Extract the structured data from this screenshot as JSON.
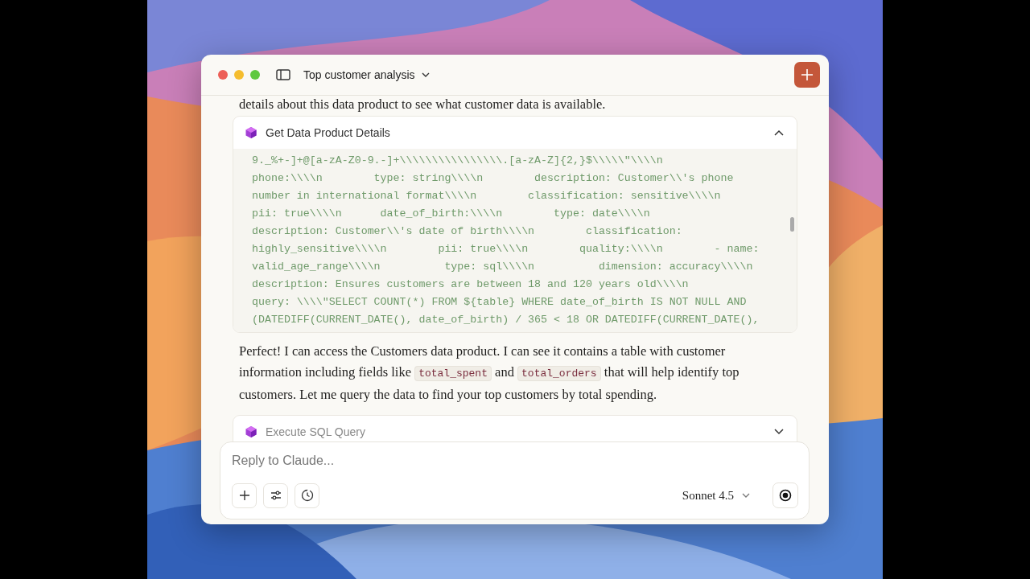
{
  "window": {
    "title": "Top customer analysis"
  },
  "messages": [
    {
      "kind": "text",
      "parts": [
        {
          "kind": "text",
          "text": "details about this data product to see what customer data is available."
        }
      ]
    },
    {
      "kind": "tool",
      "title": "Get Data Product Details",
      "expanded": true,
      "code": [
        "9._%+-]+@[a-zA-Z0-9.-]+\\\\\\\\\\\\\\\\\\\\\\\\\\\\\\\\.[a-zA-Z]{2,}$\\\\\\\\\\\"\\\\\\\\n",
        "phone:\\\\\\\\n        type: string\\\\\\\\n        description: Customer\\\\'s phone",
        "number in international format\\\\\\\\n        classification: sensitive\\\\\\\\n",
        "pii: true\\\\\\\\n      date_of_birth:\\\\\\\\n        type: date\\\\\\\\n",
        "description: Customer\\\\'s date of birth\\\\\\\\n        classification:",
        "highly_sensitive\\\\\\\\n        pii: true\\\\\\\\n        quality:\\\\\\\\n        - name:",
        "valid_age_range\\\\\\\\n          type: sql\\\\\\\\n          dimension: accuracy\\\\\\\\n",
        "description: Ensures customers are between 18 and 120 years old\\\\\\\\n",
        "query: \\\\\\\\\"SELECT COUNT(*) FROM ${table} WHERE date_of_birth IS NOT NULL AND",
        "(DATEDIFF(CURRENT_DATE(), date_of_birth) / 365 < 18 OR DATEDIFF(CURRENT_DATE(),"
      ]
    },
    {
      "kind": "text",
      "parts": [
        {
          "kind": "text",
          "text": "Perfect! I can access the Customers data product. I can see it contains a table with customer information including fields like "
        },
        {
          "kind": "code",
          "text": "total_spent"
        },
        {
          "kind": "text",
          "text": " and "
        },
        {
          "kind": "code",
          "text": "total_orders"
        },
        {
          "kind": "text",
          "text": " that will help identify top customers. Let me query the data to find your top customers by total spending."
        }
      ]
    },
    {
      "kind": "tool",
      "title": "Execute SQL Query",
      "expanded": false
    }
  ],
  "composer": {
    "placeholder": "Reply to Claude...",
    "model": "Sonnet 4.5"
  }
}
